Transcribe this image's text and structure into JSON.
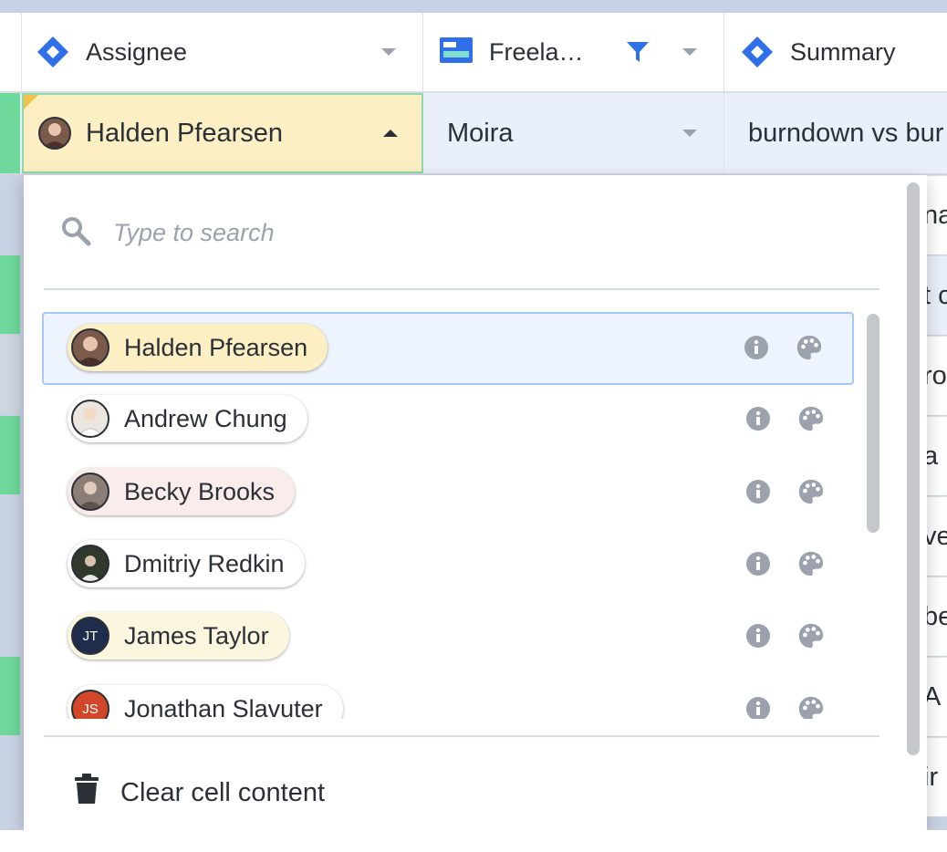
{
  "header": {
    "columns": [
      {
        "label": "Assignee"
      },
      {
        "label": "Freela…"
      },
      {
        "label": "Summary"
      }
    ]
  },
  "row1": {
    "assignee": "Halden Pfearsen",
    "freelancer": "Moira",
    "summary": "burndown vs bur"
  },
  "right_fragments": [
    "na",
    "t c",
    "ro",
    "a",
    "ve",
    "be",
    "A",
    "ir"
  ],
  "dropdown": {
    "search_placeholder": "Type to search",
    "search_value": "",
    "items": [
      {
        "name": "Halden Pfearsen",
        "initials": "",
        "chip_color": "#fcefc3",
        "avatar_color": "#7a5a4a"
      },
      {
        "name": "Andrew Chung",
        "initials": "",
        "chip_color": "#ffffff",
        "avatar_color": "#e9e2dc"
      },
      {
        "name": "Becky Brooks",
        "initials": "",
        "chip_color": "#fbecec",
        "avatar_color": "#8b7e76"
      },
      {
        "name": "Dmitriy Redkin",
        "initials": "",
        "chip_color": "#ffffff",
        "avatar_color": "#2f3a2c"
      },
      {
        "name": "James Taylor",
        "initials": "JT",
        "chip_color": "#fdf6df",
        "avatar_color": "#1f2d4d"
      },
      {
        "name": "Jonathan Slavuter",
        "initials": "JS",
        "chip_color": "#ffffff",
        "avatar_color": "#d2472a"
      }
    ],
    "clear_label": "Clear cell content"
  },
  "colors": {
    "accent_blue": "#2f6fe8",
    "selected_cell": "#fcefc3",
    "green_strip": "#6fd89b"
  },
  "icons": [
    "jira-issue-icon",
    "freelancer-field-icon",
    "filter-icon",
    "search-icon",
    "info-icon",
    "palette-icon",
    "trash-icon"
  ]
}
